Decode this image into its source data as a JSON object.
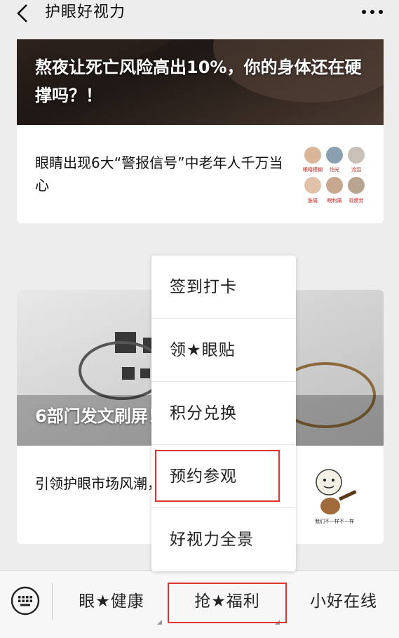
{
  "header": {
    "title": "护眼好视力",
    "back_icon": "chevron-left-icon",
    "more_icon": "more-dots-icon"
  },
  "articles": [
    {
      "hero_title": "熬夜让死亡风险高出10%，你的身体还在硬撑吗？！",
      "row_text": "眼睛出现6大“警报信号”中老年人千万当心",
      "thumb_labels": [
        "眼睛模糊",
        "怕光",
        "流泪",
        "胀痛",
        "眼刺痛",
        "视疲劳"
      ]
    },
    {
      "hero_title": "6部门发文刷屏！“可治愈”不能信！",
      "row_text": "引领护眼市场风潮，果然不一样！",
      "thumb_caption": "我们不一样不一样"
    }
  ],
  "popup_menu": {
    "items": [
      "签到打卡",
      "领★眼贴",
      "积分兑换",
      "预约参观",
      "好视力全景"
    ],
    "highlighted_index": 3
  },
  "bottom_menu": {
    "keyboard_icon": "keyboard-icon",
    "items": [
      "眼★健康",
      "抢★福利",
      "小好在线"
    ],
    "active_index": 1
  },
  "colors": {
    "highlight": "#e0332f",
    "background": "#ededed"
  }
}
